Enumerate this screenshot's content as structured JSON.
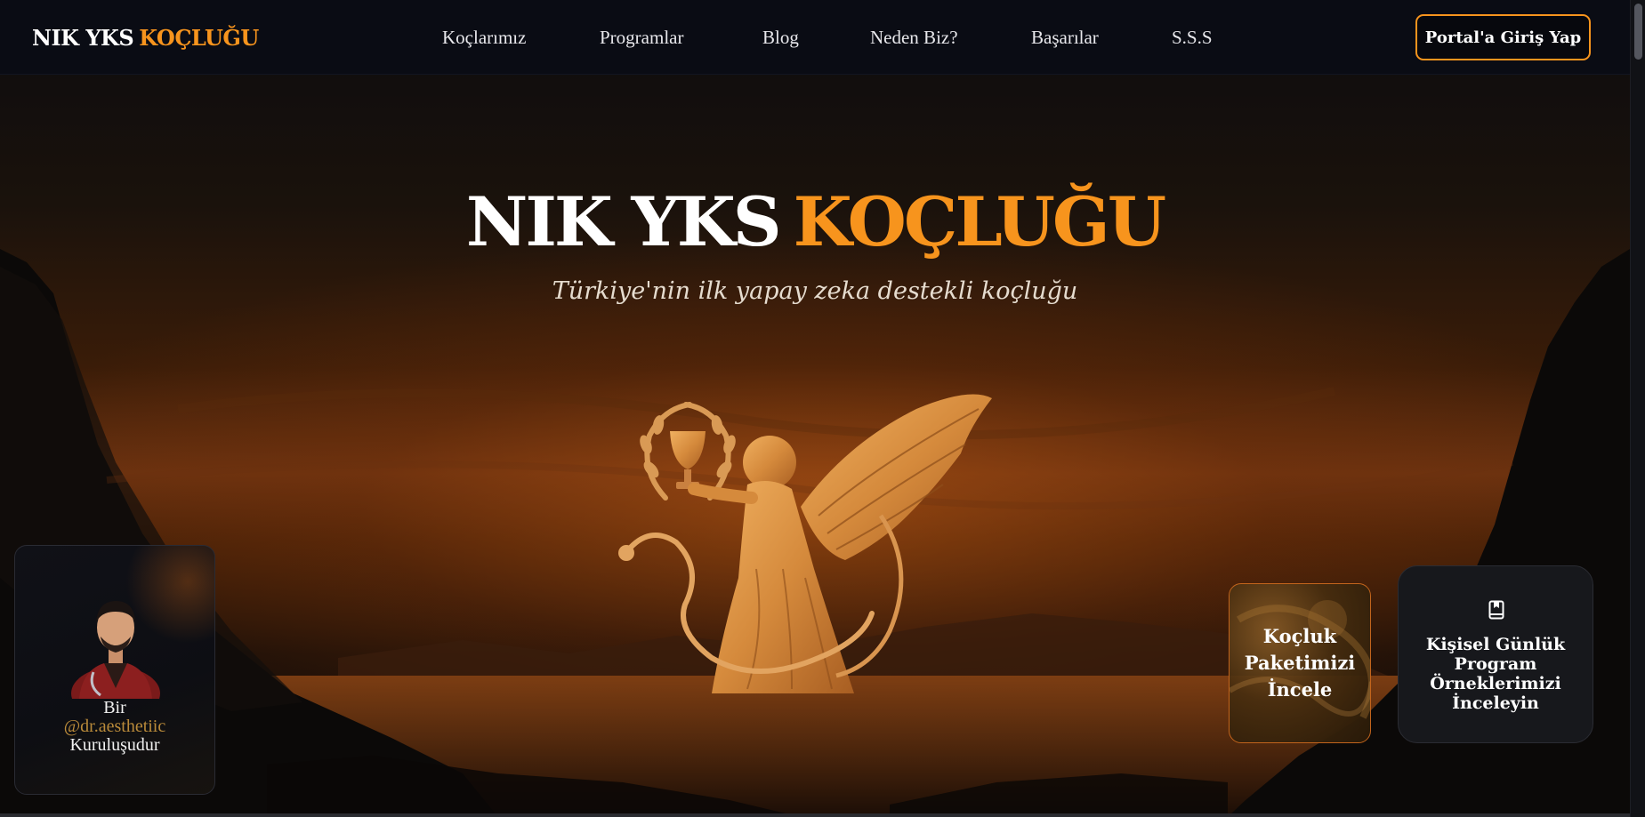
{
  "header": {
    "logo_white": "NIK YKS",
    "logo_orange": "KOÇLUĞU",
    "nav": [
      "Koçlarımız",
      "Programlar",
      "Blog",
      "Neden Biz?",
      "Başarılar",
      "S.S.S"
    ],
    "portal_button": "Portal'a Giriş Yap"
  },
  "hero": {
    "title_white": "NIK YKS",
    "title_orange": "KOÇLUĞU",
    "subtitle": "Türkiye'nin ilk yapay zeka destekli koçluğu"
  },
  "founder_card": {
    "line1": "Bir",
    "handle": "@dr.aesthetiic",
    "line3": "Kuruluşudur"
  },
  "cta": {
    "package": [
      "Koçluk",
      "Paketimizi",
      "İncele"
    ],
    "program": [
      "Kişisel Günlük",
      "Program",
      "Örneklerimizi",
      "İnceleyin"
    ]
  },
  "colors": {
    "accent": "#f7941d",
    "header_bg": "#0a0c14",
    "card_bg": "#17181c"
  },
  "icons": {
    "book": "book-bookmark-icon"
  }
}
